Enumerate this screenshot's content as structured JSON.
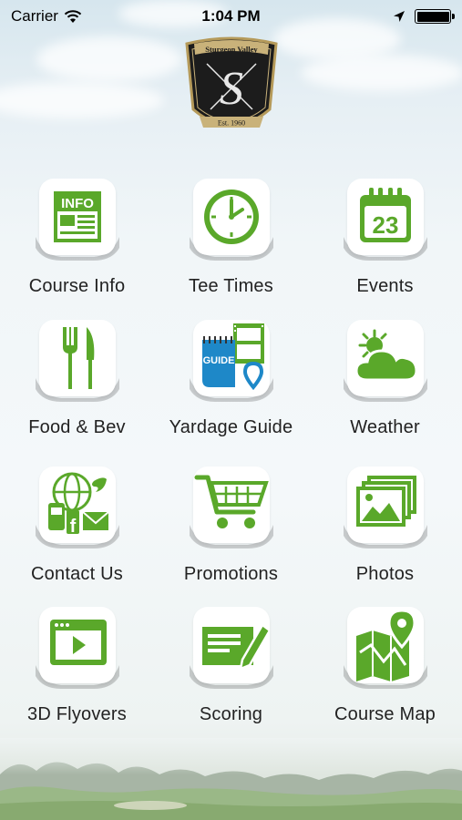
{
  "status_bar": {
    "carrier": "Carrier",
    "time": "1:04 PM",
    "icons": [
      "wifi-icon",
      "location-arrow-icon",
      "battery-icon"
    ]
  },
  "logo": {
    "club_name": "Sturgeon Valley",
    "monogram": "S",
    "established": "Est. 1960"
  },
  "accent_color": "#5aa82a",
  "menu": [
    {
      "label": "Course Info",
      "icon": "course-info-icon",
      "badge": "INFO"
    },
    {
      "label": "Tee Times",
      "icon": "clock-icon"
    },
    {
      "label": "Events",
      "icon": "calendar-icon",
      "badge": "23"
    },
    {
      "label": "Food & Bev",
      "icon": "fork-knife-icon"
    },
    {
      "label": "Yardage Guide",
      "icon": "yardage-guide-icon",
      "badge": "GUIDE"
    },
    {
      "label": "Weather",
      "icon": "sun-cloud-icon"
    },
    {
      "label": "Contact Us",
      "icon": "contact-icon"
    },
    {
      "label": "Promotions",
      "icon": "shopping-cart-icon"
    },
    {
      "label": "Photos",
      "icon": "photos-icon"
    },
    {
      "label": "3D Flyovers",
      "icon": "video-player-icon"
    },
    {
      "label": "Scoring",
      "icon": "scorecard-pencil-icon"
    },
    {
      "label": "Course Map",
      "icon": "map-pin-icon"
    }
  ]
}
